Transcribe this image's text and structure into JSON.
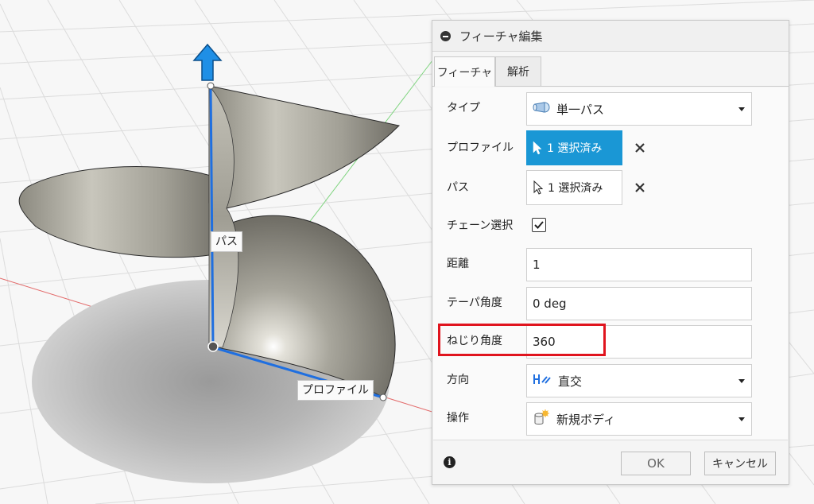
{
  "dialog": {
    "title": "フィーチャ編集",
    "tabs": [
      {
        "label": "フィーチャ",
        "active": true
      },
      {
        "label": "解析",
        "active": false
      }
    ],
    "fields": {
      "type": {
        "label": "タイプ",
        "value": "単一パス",
        "icon": "sweep-type-icon"
      },
      "profile": {
        "label": "プロファイル",
        "value": "1 選択済み",
        "state": "active"
      },
      "path": {
        "label": "パス",
        "value": "1 選択済み",
        "state": "inactive"
      },
      "chain": {
        "label": "チェーン選択",
        "checked": true
      },
      "distance": {
        "label": "距離",
        "value": "1"
      },
      "taper": {
        "label": "テーパ角度",
        "value": "0 deg"
      },
      "twist": {
        "label": "ねじり角度",
        "value": "360"
      },
      "orientation": {
        "label": "方向",
        "value": "直交",
        "icon": "orientation-icon"
      },
      "operation": {
        "label": "操作",
        "value": "新規ボディ",
        "icon": "new-body-icon"
      }
    },
    "buttons": {
      "ok": "OK",
      "cancel": "キャンセル"
    },
    "info_icon": "i"
  },
  "viewport": {
    "path_label": "パス",
    "profile_label": "プロファイル"
  },
  "colors": {
    "accent": "#1a97d5",
    "highlight": "#e0141e",
    "path_line": "#1f6fe0",
    "axis_x": "#e36b6b",
    "axis_y": "#7fd47f"
  }
}
